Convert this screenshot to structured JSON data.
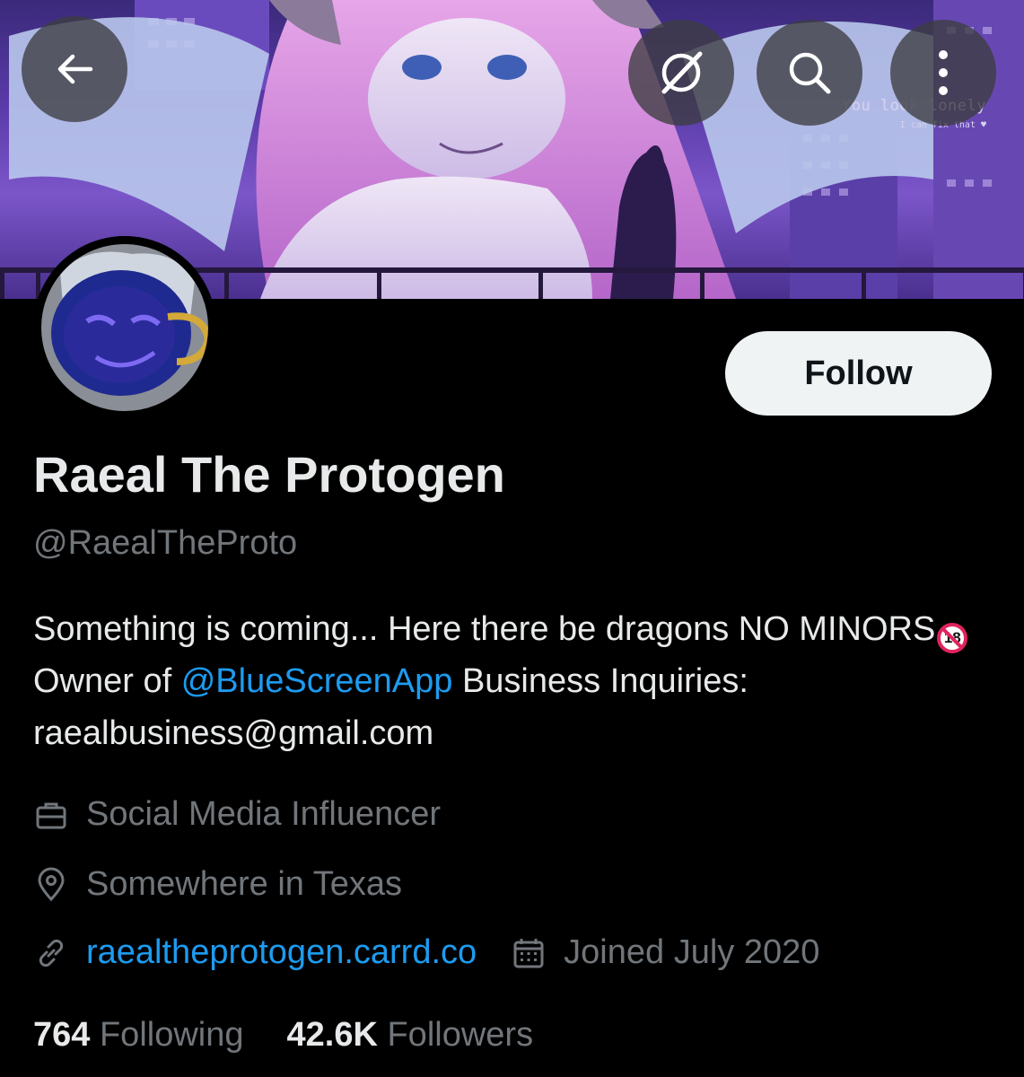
{
  "banner": {
    "caption_main": "You look lonely",
    "caption_sub": "I can fix that ♥"
  },
  "nav": {
    "back_icon": "arrow-left-icon",
    "grok_icon": "grok-icon",
    "search_icon": "search-icon",
    "more_icon": "more-vertical-icon"
  },
  "profile": {
    "display_name": "Raeal The Protogen",
    "handle": "@RaealTheProto",
    "follow_label": "Follow",
    "bio": {
      "part1": "Something is coming... Here there be dragons  NO MINORS",
      "no_minors_badge": "18",
      "part2": "  Owner of ",
      "mention": "@BlueScreenApp",
      "part3": "  Business Inquiries: raealbusiness@gmail.com"
    },
    "category": "Social Media Influencer",
    "location": "Somewhere in Texas",
    "url": "raealtheprotogen.carrd.co",
    "joined": "Joined July 2020"
  },
  "stats": {
    "following_count": "764",
    "following_label": "Following",
    "followers_count": "42.6K",
    "followers_label": "Followers"
  },
  "colors": {
    "background": "#000000",
    "primary_text": "#e7e9ea",
    "secondary_text": "#71767b",
    "link": "#1d9bf0",
    "follow_button": "#eff3f4"
  }
}
